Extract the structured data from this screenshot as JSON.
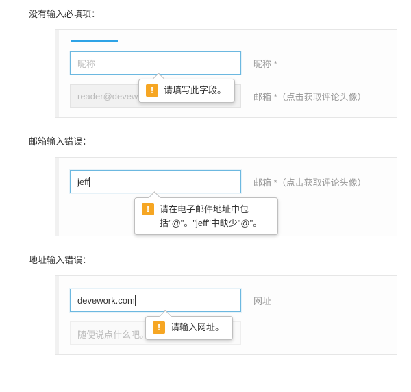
{
  "sections": {
    "required": {
      "title": "没有输入必填项："
    },
    "email": {
      "title": "邮箱输入错误："
    },
    "url": {
      "title": "地址输入错误："
    }
  },
  "fields": {
    "nickname": {
      "placeholder": "昵称",
      "label": "昵称 *"
    },
    "emailReadonly": {
      "value": "reader@devework.c...",
      "label": "邮箱 *（点击获取评论头像）"
    },
    "emailInput": {
      "value": "jeff",
      "label": "邮箱 *（点击获取评论头像）"
    },
    "urlInput": {
      "value": "devework.com",
      "label": "网址"
    },
    "commentBox": {
      "placeholder": "随便说点什么吧。. ."
    }
  },
  "tooltips": {
    "required": "请填写此字段。",
    "email": "请在电子邮件地址中包括\"@\"。\"jeff\"中缺少\"@\"。",
    "url": "请输入网址。"
  }
}
